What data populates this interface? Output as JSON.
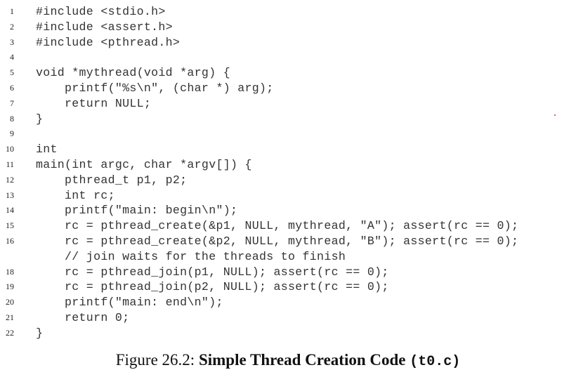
{
  "listing": {
    "lines": [
      {
        "n": "1",
        "code": "#include <stdio.h>"
      },
      {
        "n": "2",
        "code": "#include <assert.h>"
      },
      {
        "n": "3",
        "code": "#include <pthread.h>"
      },
      {
        "n": "4",
        "code": ""
      },
      {
        "n": "5",
        "code": "void *mythread(void *arg) {"
      },
      {
        "n": "6",
        "code": "    printf(\"%s\\n\", (char *) arg);"
      },
      {
        "n": "7",
        "code": "    return NULL;"
      },
      {
        "n": "8",
        "code": "}"
      },
      {
        "n": "9",
        "code": ""
      },
      {
        "n": "10",
        "code": "int"
      },
      {
        "n": "11",
        "code": "main(int argc, char *argv[]) {"
      },
      {
        "n": "12",
        "code": "    pthread_t p1, p2;"
      },
      {
        "n": "13",
        "code": "    int rc;"
      },
      {
        "n": "14",
        "code": "    printf(\"main: begin\\n\");"
      },
      {
        "n": "15",
        "code": "    rc = pthread_create(&p1, NULL, mythread, \"A\"); assert(rc == 0);"
      },
      {
        "n": "16",
        "code": "    rc = pthread_create(&p2, NULL, mythread, \"B\"); assert(rc == 0);"
      },
      {
        "n": "",
        "code": "    // join waits for the threads to finish"
      },
      {
        "n": "18",
        "code": "    rc = pthread_join(p1, NULL); assert(rc == 0);"
      },
      {
        "n": "19",
        "code": "    rc = pthread_join(p2, NULL); assert(rc == 0);"
      },
      {
        "n": "20",
        "code": "    printf(\"main: end\\n\");"
      },
      {
        "n": "21",
        "code": "    return 0;"
      },
      {
        "n": "22",
        "code": "}"
      }
    ]
  },
  "caption": {
    "prefix": "Figure 26.2: ",
    "title": "Simple Thread Creation Code ",
    "file": "(t0.c)"
  }
}
